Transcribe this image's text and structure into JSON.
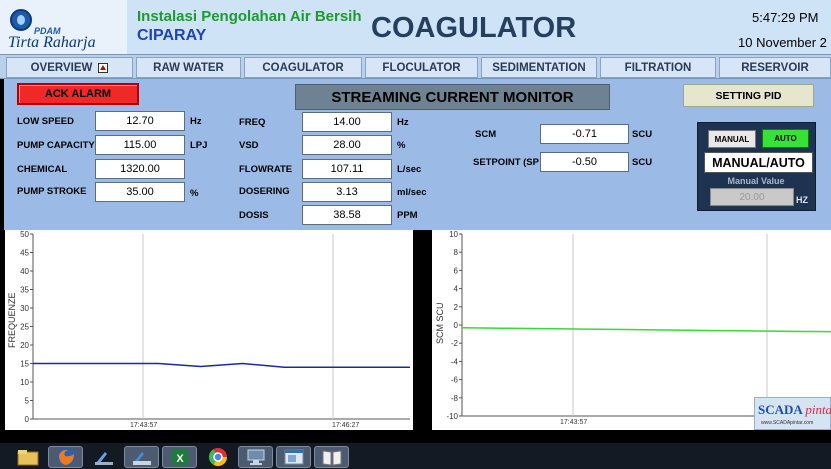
{
  "header": {
    "logo_pdam": "PDAM",
    "logo_name": "Tirta Raharja",
    "title_line1": "Instalasi Pengolahan Air Bersih",
    "title_line2": "CIPARAY",
    "screen_title": "COAGULATOR",
    "time": "5:47:29 PM",
    "date": "10 November 2"
  },
  "nav": {
    "tabs": [
      {
        "label": "OVERVIEW",
        "icon": "alarm-indicator-icon"
      },
      {
        "label": "RAW WATER"
      },
      {
        "label": "COAGULATOR"
      },
      {
        "label": "FLOCULATOR"
      },
      {
        "label": "SEDIMENTATION"
      },
      {
        "label": "FILTRATION"
      },
      {
        "label": "RESERVOIR"
      }
    ]
  },
  "controls": {
    "ack_alarm": "ACK ALARM",
    "monitor_title": "STREAMING CURRENT MONITOR",
    "setting_pid": "SETTING PID"
  },
  "fields_left": [
    {
      "label": "LOW SPEED",
      "value": "12.70",
      "unit": "Hz"
    },
    {
      "label": "PUMP CAPACITY",
      "value": "115.00",
      "unit": "LPJ"
    },
    {
      "label": "CHEMICAL",
      "value": "1320.00",
      "unit": ""
    },
    {
      "label": "PUMP STROKE",
      "value": "35.00",
      "unit": "%"
    }
  ],
  "fields_mid": [
    {
      "label": "FREQ",
      "value": "14.00",
      "unit": "Hz"
    },
    {
      "label": "VSD",
      "value": "28.00",
      "unit": "%"
    },
    {
      "label": "FLOWRATE",
      "value": "107.11",
      "unit": "L/sec"
    },
    {
      "label": "DOSERING",
      "value": "3.13",
      "unit": "ml/sec"
    },
    {
      "label": "DOSIS",
      "value": "38.58",
      "unit": "PPM"
    }
  ],
  "fields_right": [
    {
      "label": "SCM",
      "value": "-0.71",
      "unit": "SCU"
    },
    {
      "label": "SETPOINT (SP",
      "value": "-0.50",
      "unit": "SCU"
    }
  ],
  "mode_panel": {
    "manual_button": "MANUAL",
    "auto_button": "AUTO",
    "mode_label": "MANUAL/AUTO",
    "manual_value_label": "Manual Value",
    "manual_value": "20.00",
    "manual_value_unit": "HZ",
    "colors": {
      "auto_active": "#38e038"
    }
  },
  "chart_data": [
    {
      "type": "line",
      "ylabel": "FREQUENZE",
      "ylim": [
        0,
        50
      ],
      "yticks": [
        "0",
        "5",
        "10",
        "15",
        "20",
        "25",
        "30",
        "35",
        "40",
        "45",
        "50"
      ],
      "xticks": [
        "17:43:57",
        "17:46:27"
      ],
      "grid": true,
      "series": [
        {
          "values": [
            15,
            15,
            15,
            15,
            14.2,
            15,
            14,
            14,
            14,
            14
          ],
          "color": "#1a2a9a"
        }
      ]
    },
    {
      "type": "line",
      "ylabel": "SCM SCU",
      "ylim": [
        -10,
        10
      ],
      "yticks": [
        "-10",
        "-8",
        "-6",
        "-4",
        "-2",
        "0",
        "2",
        "4",
        "6",
        "8",
        "10"
      ],
      "xticks": [
        "17:43:57",
        "17"
      ],
      "grid": true,
      "series": [
        {
          "values": [
            -0.3,
            -0.35,
            -0.4,
            -0.45,
            -0.5,
            -0.55,
            -0.6,
            -0.65,
            -0.7,
            -0.72
          ],
          "color": "#33dd33"
        }
      ]
    }
  ],
  "watermark": {
    "brand": "SCADA",
    "brand2": "pintar",
    "site": "www.SCADApintar.com"
  },
  "taskbar": {
    "items": [
      {
        "icon": "file-explorer-icon"
      },
      {
        "icon": "firefox-icon"
      },
      {
        "icon": "scada-tool-icon"
      },
      {
        "icon": "scada-runtime-icon"
      },
      {
        "icon": "excel-icon"
      },
      {
        "icon": "chrome-icon"
      },
      {
        "icon": "network-icon"
      },
      {
        "icon": "window-app-icon"
      },
      {
        "icon": "book-icon"
      }
    ]
  }
}
